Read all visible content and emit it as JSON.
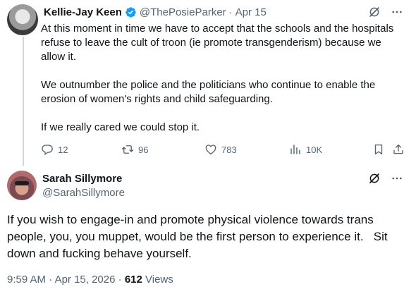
{
  "parent_tweet": {
    "author_name": "Kellie-Jay Keen",
    "handle": "@ThePosieParker",
    "separator": "·",
    "date": "Apr 15",
    "paragraphs": [
      "At this moment in time we have to accept that the schools and the hospitals refuse to leave the cult of troon (ie promote transgenderism) because we allow it.",
      "We outnumber the police and the politicians who continue to enable the erosion of women's rights and child safeguarding.",
      "If we really cared we could stop it."
    ],
    "actions": {
      "replies": "12",
      "retweets": "96",
      "likes": "783",
      "views": "10K"
    },
    "icons": [
      "verified-badge-icon",
      "grok-icon",
      "more-icon",
      "reply-icon",
      "retweet-icon",
      "like-icon",
      "views-icon",
      "bookmark-icon",
      "share-icon"
    ]
  },
  "main_tweet": {
    "author_name": "Sarah Sillymore",
    "handle": "@SarahSillymore",
    "text": "If you wish to engage-in and promote physical violence towards trans people, you, you muppet, would be the first person to experience it.   Sit down and fucking behave yourself.",
    "time": "9:59 AM",
    "separator": "·",
    "date": "Apr 15, 2026",
    "separator2": "·",
    "views_count": "612",
    "views_label": "Views"
  },
  "colors": {
    "text_primary": "#0f1419",
    "text_secondary": "#536471",
    "verified_blue": "#1d9bf0",
    "thread_line": "#cfd9de"
  }
}
